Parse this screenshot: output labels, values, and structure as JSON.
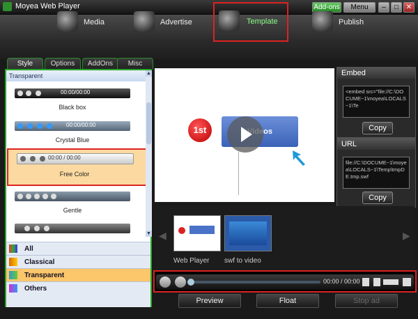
{
  "window": {
    "title": "Moyea Web Player",
    "addons_label": "Add-ons",
    "menu_label": "Menu",
    "min_label": "–",
    "max_label": "□",
    "close_label": "✕"
  },
  "nav": {
    "items": [
      {
        "label": "Media",
        "icon": "film-icon"
      },
      {
        "label": "Advertise",
        "icon": "advertise-icon"
      },
      {
        "label": "Template",
        "icon": "template-icon",
        "active": true
      },
      {
        "label": "Publish",
        "icon": "publish-icon"
      }
    ]
  },
  "tabs": [
    {
      "label": "Style",
      "active": true
    },
    {
      "label": "Options"
    },
    {
      "label": "AddOns"
    },
    {
      "label": "Misc"
    }
  ],
  "style_list": {
    "header": "Transparent",
    "skins": [
      {
        "name": "Black box",
        "time": "00:00/00:00"
      },
      {
        "name": "Crystal Blue",
        "time": "00:00/00:00"
      },
      {
        "name": "Free Color",
        "time": "00:00 / 00:00",
        "selected": true
      },
      {
        "name": "Gentle",
        "time": ""
      }
    ],
    "scroll_up": "▲",
    "scroll_down": "▼"
  },
  "categories": [
    {
      "label": "All"
    },
    {
      "label": "Classical"
    },
    {
      "label": "Transparent",
      "active": true
    },
    {
      "label": "Others"
    }
  ],
  "preview": {
    "badge": "1st",
    "box_text": "Videos"
  },
  "embed": {
    "title": "Embed",
    "code": "<embed src=\"file://C:\\DOCUME~1\\moyea\\LOCALS~1\\Te",
    "copy_label": "Copy"
  },
  "url": {
    "title": "URL",
    "code": "file://C:\\DOCUME~1\\moyea\\LOCALS~1\\Temp\\tmpDE.tmp.swf",
    "copy_label": "Copy"
  },
  "thumbnails": [
    {
      "label": "Web Player"
    },
    {
      "label": "swf to video"
    }
  ],
  "player": {
    "time": "00:00 / 00:00"
  },
  "buttons": {
    "preview": "Preview",
    "float": "Float",
    "stop_ad": "Stop ad"
  },
  "colors": {
    "accent_green": "#2aa82a",
    "highlight_red": "#d22222",
    "selected_orange": "#fbd9a0"
  }
}
